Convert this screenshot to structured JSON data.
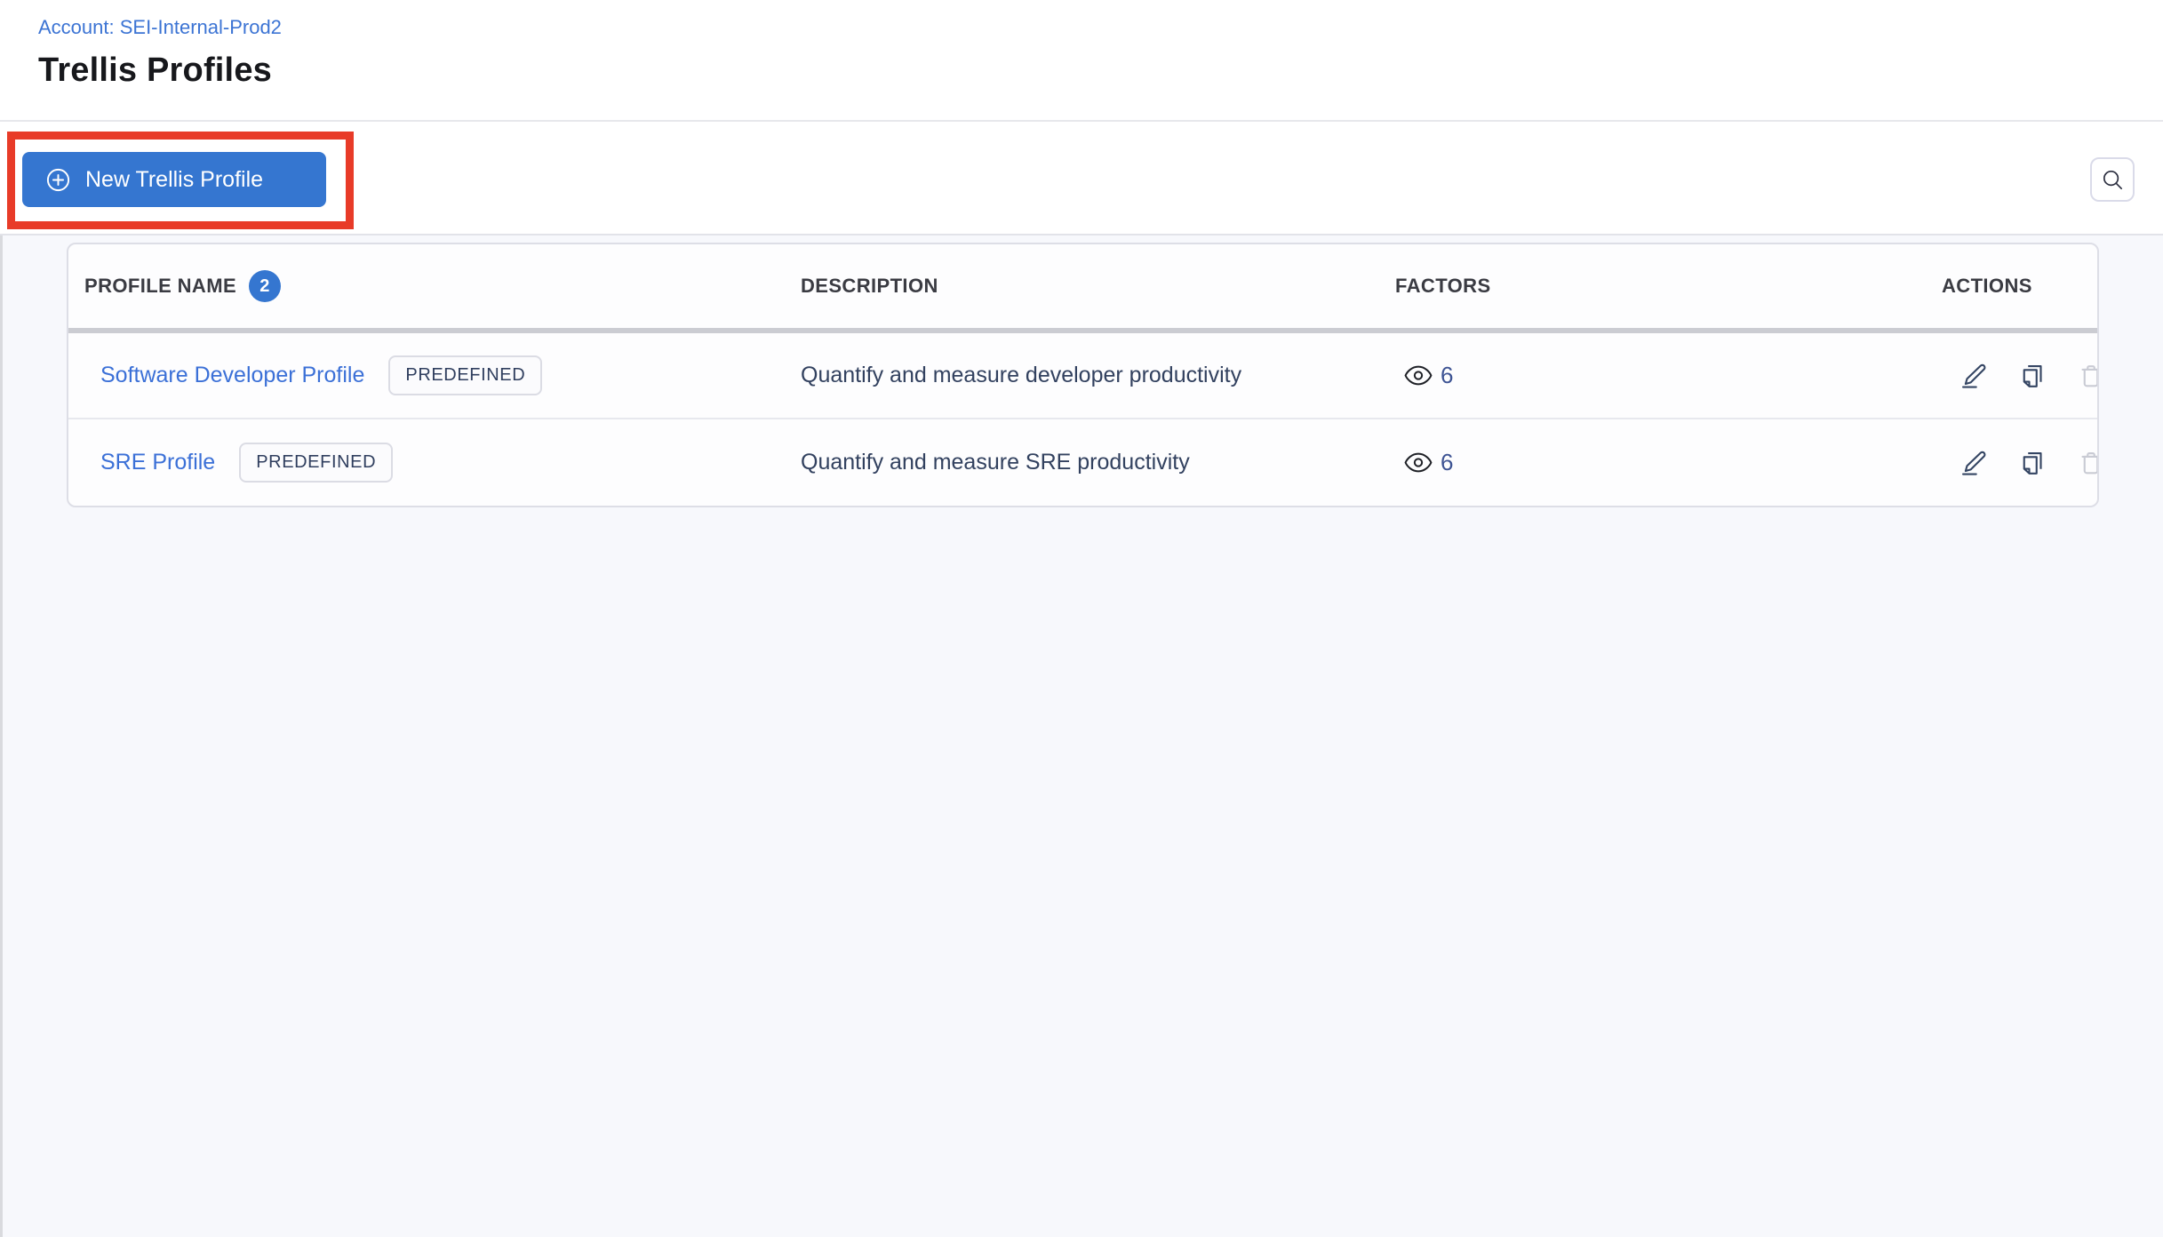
{
  "header": {
    "account_link": "Account: SEI-Internal-Prod2",
    "title": "Trellis Profiles"
  },
  "toolbar": {
    "new_profile_button_label": "New Trellis Profile",
    "new_profile_button_icon": "plus-circle-icon",
    "search_icon": "magnifier-icon",
    "annotation": "red-highlight-rectangle"
  },
  "table": {
    "columns": [
      "PROFILE NAME",
      "DESCRIPTION",
      "FACTORS",
      "ACTIONS"
    ],
    "profile_count": "2",
    "factors_icon": "eye-icon",
    "action_icons": [
      "edit-pencil-icon",
      "copy-icon",
      "trash-icon"
    ],
    "rows": [
      {
        "name": "Software Developer Profile",
        "tag": "PREDEFINED",
        "description": "Quantify and measure developer productivity",
        "factors": "6"
      },
      {
        "name": "SRE Profile",
        "tag": "PREDEFINED",
        "description": "Quantify and measure SRE productivity",
        "factors": "6"
      }
    ]
  },
  "colors": {
    "accent_blue": "#3576d0",
    "link_blue": "#3b70d7",
    "annotation_red": "#e83b28",
    "navy_text": "#32415f",
    "header_text": "#3a3b42",
    "disabled_icon_gray": "#c9cbd4",
    "page_background": "#f7f8fc"
  }
}
